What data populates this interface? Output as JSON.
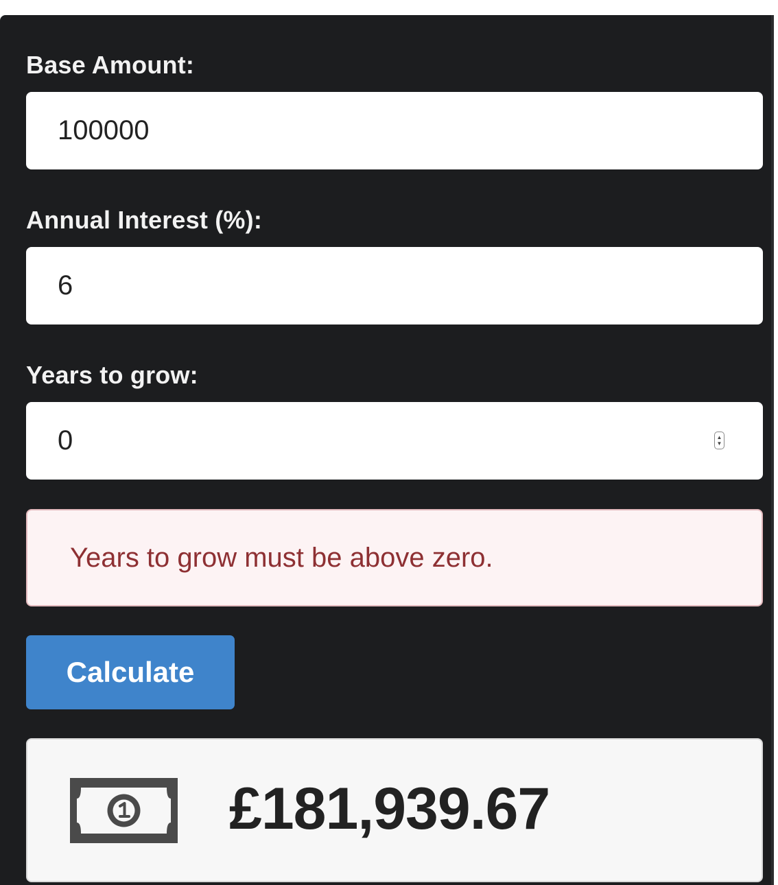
{
  "form": {
    "base_amount": {
      "label": "Base Amount:",
      "value": "100000"
    },
    "annual_interest": {
      "label": "Annual Interest (%):",
      "value": "6"
    },
    "years": {
      "label": "Years to grow:",
      "value": "0"
    }
  },
  "error": {
    "message": "Years to grow must be above zero."
  },
  "actions": {
    "calculate_label": "Calculate"
  },
  "result": {
    "icon": "money-bill-icon",
    "value": "£181,939.67"
  },
  "colors": {
    "panel_bg": "#1c1d1f",
    "button_bg": "#3f84cb",
    "error_bg": "#fdf3f4",
    "error_text": "#8e3033",
    "result_bg": "#f7f7f7"
  }
}
